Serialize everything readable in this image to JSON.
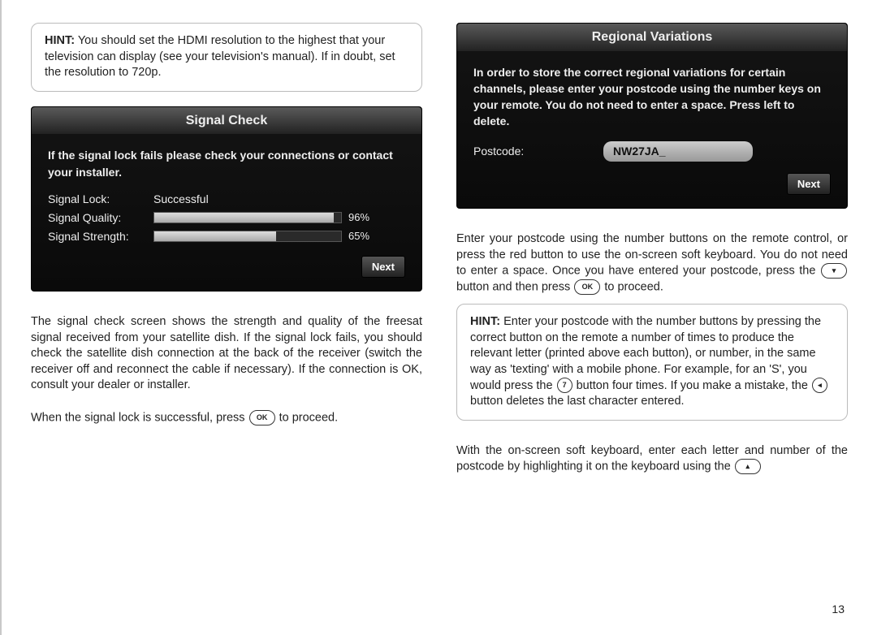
{
  "left": {
    "hint": {
      "label": "HINT:",
      "body": "You should set the HDMI resolution to the highest that your television can display (see your television's manual). If in doubt, set the resolution to 720p."
    },
    "panel": {
      "title": "Signal Check",
      "instr": "If the signal lock fails please check your connections or contact your installer.",
      "lock_label": "Signal Lock:",
      "lock_value": "Successful",
      "quality_label": "Signal Quality:",
      "quality_pct": "96%",
      "quality_fill": 96,
      "strength_label": "Signal Strength:",
      "strength_pct": "65%",
      "strength_fill": 65,
      "next": "Next"
    },
    "para1": "The signal check screen shows the strength and quality of the freesat signal received from your satellite dish. If the signal lock fails, you should check the satellite dish connection at the back of the receiver (switch the receiver off and reconnect the cable if necessary). If the connection is OK, consult your dealer or installer.",
    "para2_a": "When the signal lock is successful, press ",
    "para2_btn": "OK",
    "para2_b": " to proceed."
  },
  "right": {
    "panel": {
      "title": "Regional Variations",
      "instr": "In order to store the correct regional variations for certain channels, please enter your postcode using the number keys on your remote. You do not need to enter a space. Press left to delete.",
      "postcode_label": "Postcode:",
      "postcode_value": "NW27JA_",
      "next": "Next"
    },
    "para1_a": "Enter your postcode using the number buttons on the remote control, or press the red button to use the on-screen soft keyboard. You do not need to enter a space. Once you have entered your postcode, press the ",
    "para1_btn1": "▾",
    "para1_mid": " button and then press ",
    "para1_btn2": "OK",
    "para1_b": " to proceed.",
    "hint": {
      "label": "HINT:",
      "body_a": "Enter your postcode with the number buttons by pressing the correct button on the remote a number of times to produce the relevant letter (printed above each button), or number, in the same way as 'texting' with a mobile phone. For example, for an 'S', you would press the ",
      "btn7": "7",
      "body_b": " button four times. If you make a mistake, the ",
      "btn_left": "◂",
      "body_c": " button deletes the last character entered."
    },
    "para2_a": "With the on-screen soft keyboard, enter each letter and number of the postcode by highlighting it on the keyboard using the ",
    "para2_btn": "▴"
  },
  "page_number": "13"
}
